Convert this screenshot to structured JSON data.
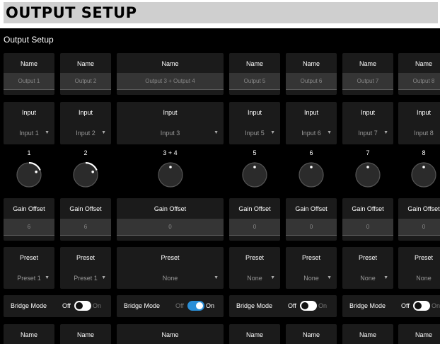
{
  "banner_title": "OUTPUT SETUP",
  "app_title": "Output Setup",
  "labels": {
    "name": "Name",
    "input": "Input",
    "gain_offset": "Gain Offset",
    "preset": "Preset",
    "bridge_mode": "Bridge Mode",
    "off": "Off",
    "on": "On"
  },
  "colors": {
    "accent": "#2a8fd8",
    "panel": "#1b1b1b",
    "field": "#353535"
  },
  "channels": [
    {
      "number": "1",
      "name": "Output 1",
      "input": "Input 1",
      "gain": "6",
      "preset": "Preset 1",
      "knob_level": 0.75
    },
    {
      "number": "2",
      "name": "Output 2",
      "input": "Input 2",
      "gain": "6",
      "preset": "Preset 1",
      "knob_level": 0.75
    },
    {
      "number": "3 + 4",
      "name": "Output 3 + Output 4",
      "input": "Input 3",
      "gain": "0",
      "preset": "None",
      "knob_level": 0.5
    },
    {
      "number": "5",
      "name": "Output 5",
      "input": "Input 5",
      "gain": "0",
      "preset": "None",
      "knob_level": 0.5
    },
    {
      "number": "6",
      "name": "Output 6",
      "input": "Input 6",
      "gain": "0",
      "preset": "None",
      "knob_level": 0.5
    },
    {
      "number": "7",
      "name": "Output 7",
      "input": "Input 7",
      "gain": "0",
      "preset": "None",
      "knob_level": 0.5
    },
    {
      "number": "8",
      "name": "Output 8",
      "input": "Input 8",
      "gain": "0",
      "preset": "None",
      "knob_level": 0.5
    }
  ],
  "bridge_groups": [
    {
      "state": "off"
    },
    {
      "state": "on"
    },
    {
      "state": "off"
    },
    {
      "state": "off"
    }
  ]
}
